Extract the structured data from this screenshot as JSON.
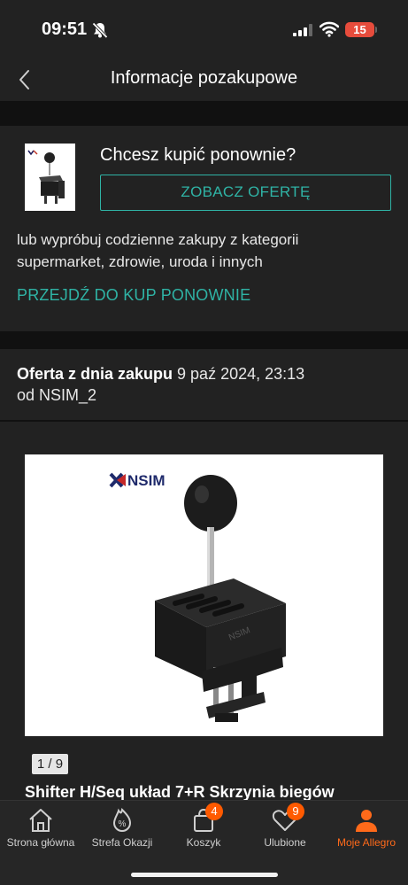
{
  "status": {
    "time": "09:51",
    "battery": "15"
  },
  "header": {
    "title": "Informacje pozakupowe"
  },
  "buy_again": {
    "title": "Chcesz kupić ponownie?",
    "button_label": "ZOBACZ OFERTĘ",
    "description": "lub wypróbuj codzienne zakupy z kategorii supermarket, zdrowie, uroda i innych",
    "link_label": "PRZEJDŹ DO KUP PONOWNIE"
  },
  "offer": {
    "prefix": "Oferta z dnia zakupu",
    "date": " 9 paź 2024, 23:13",
    "seller_line": "od NSIM_2"
  },
  "product": {
    "logo_text": "NSIM",
    "image_counter": "1 / 9",
    "title": "Shifter H/Seq układ 7+R Skrzynia biegów"
  },
  "tabbar": {
    "tabs": [
      {
        "label": "Strona główna",
        "icon": "home-icon"
      },
      {
        "label": "Strefa Okazji",
        "icon": "deals-icon"
      },
      {
        "label": "Koszyk",
        "icon": "cart-icon",
        "badge": "4"
      },
      {
        "label": "Ulubione",
        "icon": "heart-icon",
        "badge": "9"
      },
      {
        "label": "Moje Allegro",
        "icon": "user-icon",
        "active": true
      }
    ]
  },
  "colors": {
    "accent_teal": "#2fb3a5",
    "accent_orange": "#ff6a1a",
    "background": "#222222"
  }
}
